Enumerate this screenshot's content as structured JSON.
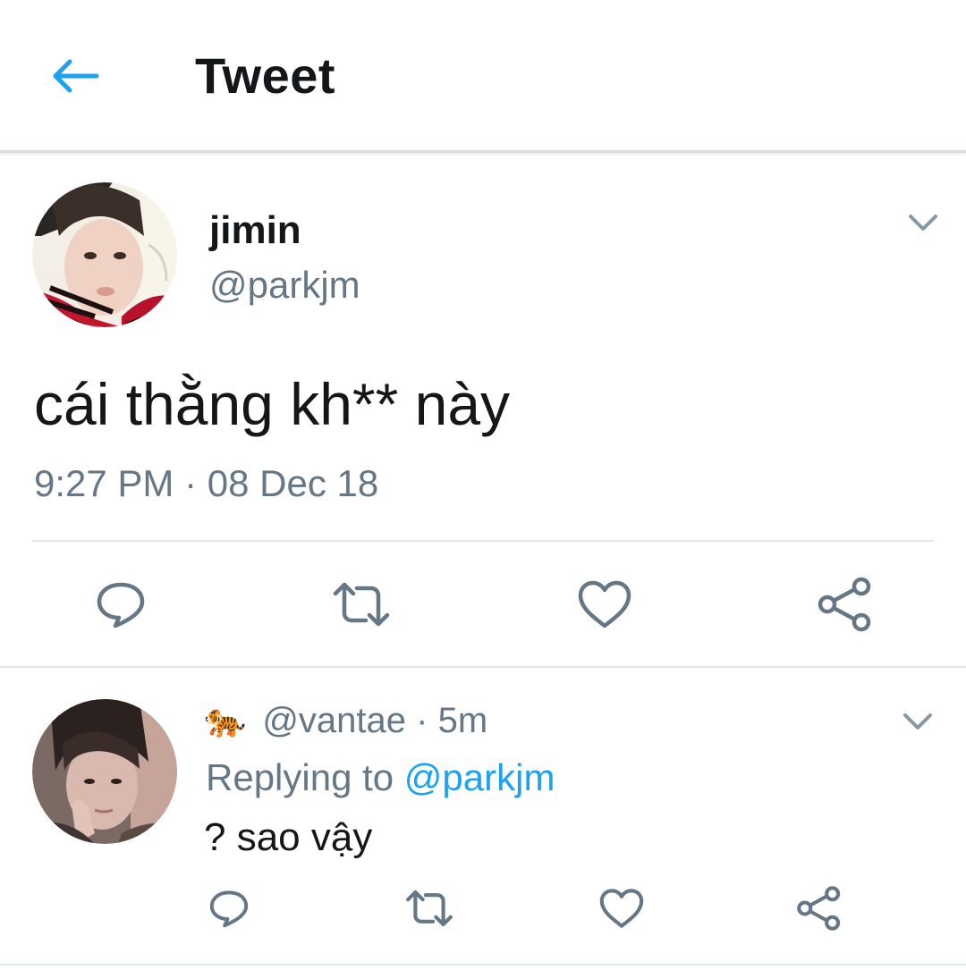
{
  "header": {
    "title": "Tweet",
    "back_icon": "arrow-left-icon",
    "accent": "#1da1f2"
  },
  "tweet": {
    "display_name": "jimin",
    "handle": "@parkjm",
    "text": "cái thằng kh** này",
    "timestamp": "9:27 PM · 08 Dec 18",
    "actions": [
      "reply-icon",
      "retweet-icon",
      "like-icon",
      "share-icon"
    ]
  },
  "reply": {
    "emoji": "🐅",
    "handle": "@vantae",
    "separator": " · ",
    "time": "5m",
    "replying_label": "Replying to ",
    "replying_to": "@parkjm",
    "text": "? sao vậy",
    "actions": [
      "reply-icon",
      "retweet-icon",
      "like-icon",
      "share-icon"
    ]
  },
  "colors": {
    "text": "#14171a",
    "secondary": "#657786",
    "link": "#1da1f2",
    "divider": "#e1e8ed"
  }
}
